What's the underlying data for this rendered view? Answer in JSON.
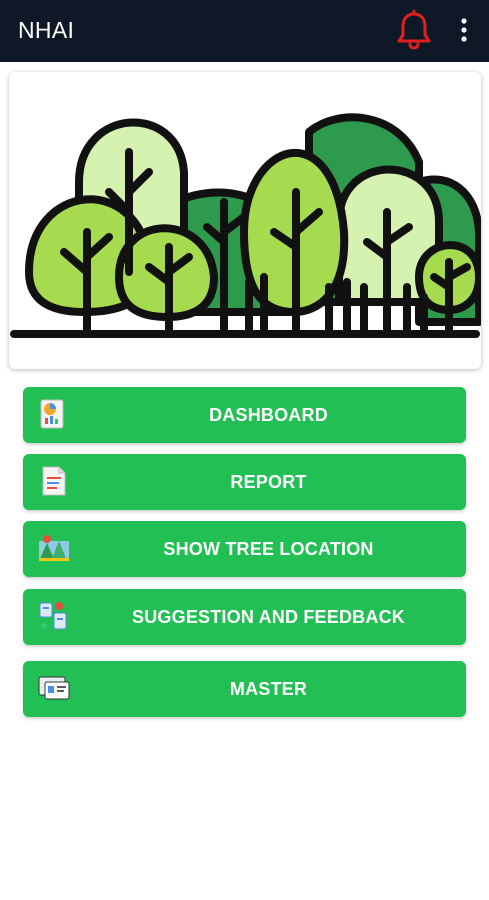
{
  "header": {
    "title": "NHAI",
    "notification_icon": "bell-icon",
    "menu_icon": "more-vertical-icon"
  },
  "banner": {
    "illustration": "trees-illustration"
  },
  "menu": {
    "items": [
      {
        "label": "DASHBOARD",
        "icon": "dashboard-report-icon"
      },
      {
        "label": "REPORT",
        "icon": "report-document-icon"
      },
      {
        "label": "SHOW TREE LOCATION",
        "icon": "tree-location-icon"
      },
      {
        "label": "SUGGESTION AND FEEDBACK",
        "icon": "feedback-icon"
      },
      {
        "label": "MASTER",
        "icon": "master-id-card-icon"
      }
    ]
  },
  "colors": {
    "topbar": "#0f1826",
    "accent_green": "#22bf54",
    "bell_red": "#e02020",
    "text_light": "#ffffff"
  }
}
